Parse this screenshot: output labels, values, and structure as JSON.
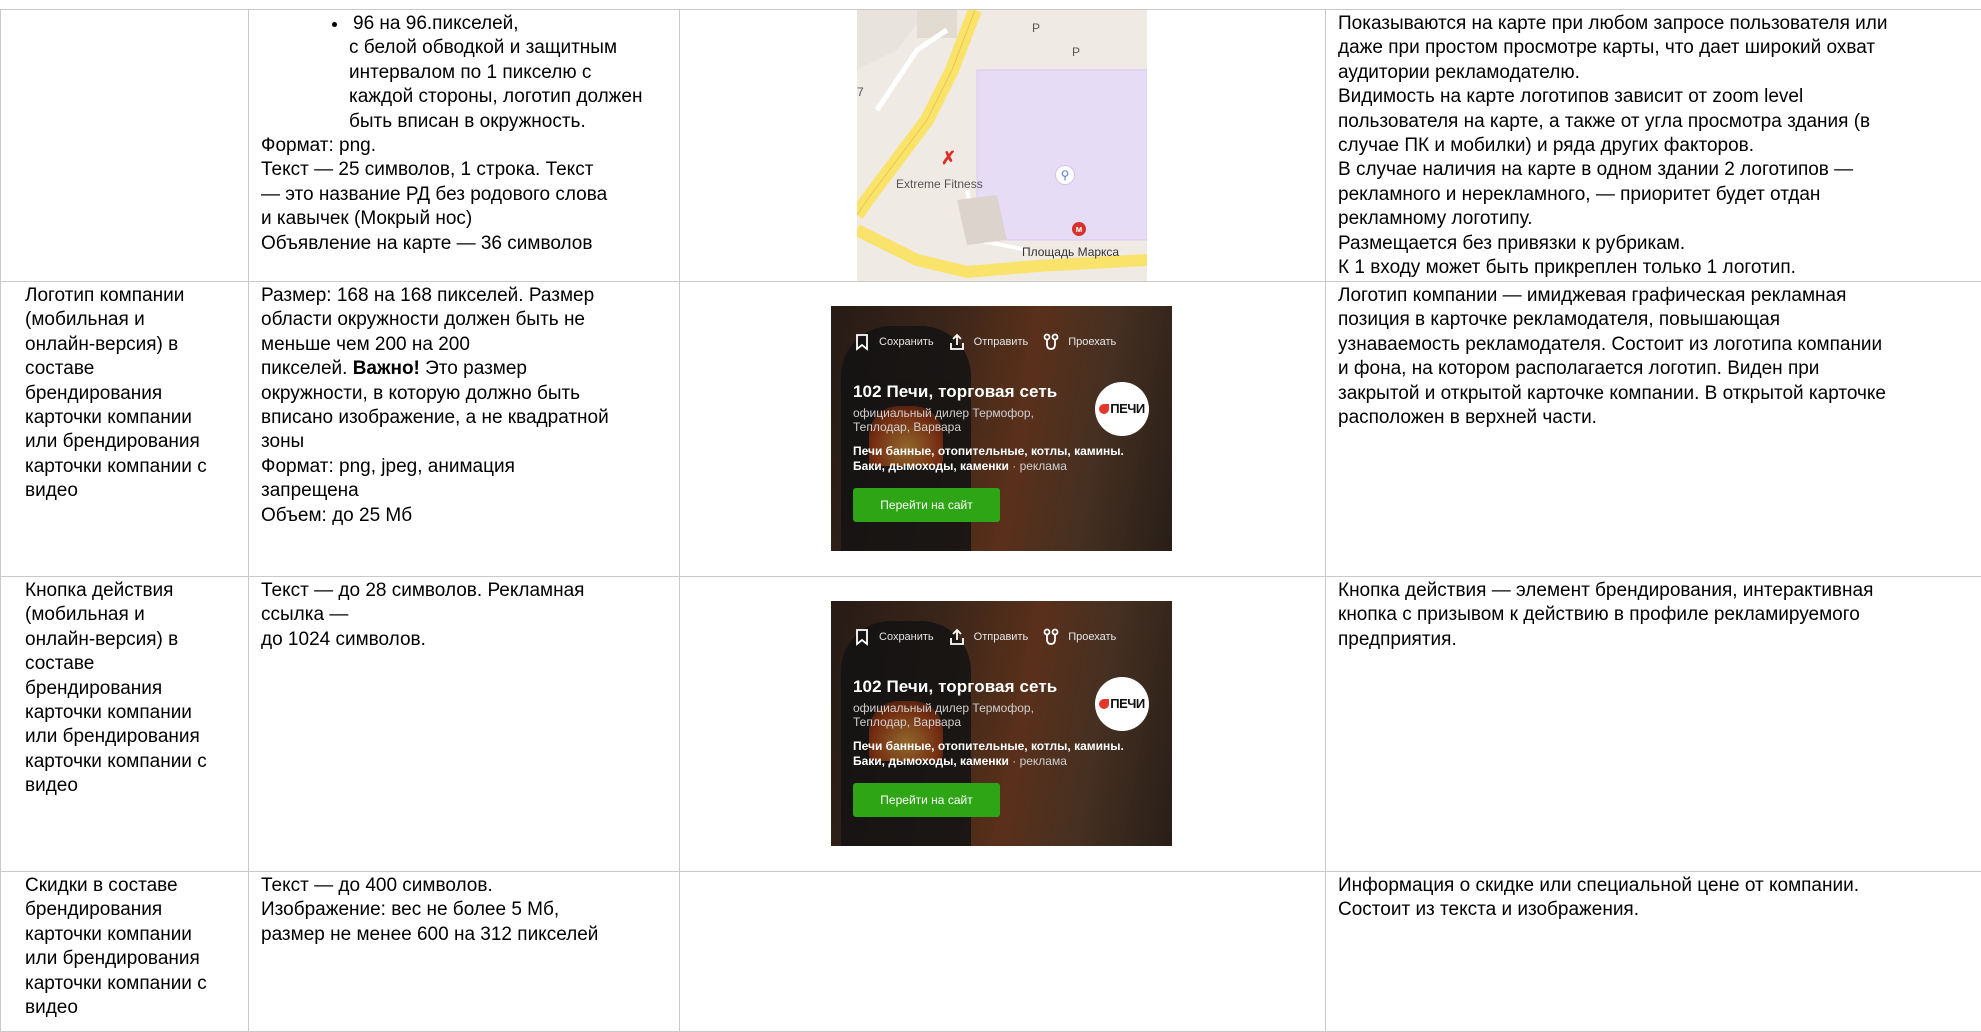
{
  "rows": [
    {
      "name": "",
      "requirements": {
        "bullet": "96 на 96.пикселей,",
        "indented": [
          "с белой обводкой и защитным",
          "интервалом по 1 пикселю с",
          "каждой стороны, логотип должен",
          "быть вписан в окружность."
        ],
        "lines": [
          "Формат: png.",
          "Текст — 25 символов, 1 строка. Текст",
          "— это название РД без родового слова",
          "и кавычек (Мокрый нос)",
          "Объявление на карте — 36 символов"
        ]
      },
      "description": [
        "Показываются на карте при любом запросе пользователя или",
        "даже при простом просмотре карты, что дает широкий охват",
        "аудитории рекламодателю.",
        "Видимость на карте логотипов зависит от zoom level",
        "пользователя на карте, а также от угла просмотра здания (в",
        "случае ПК и мобилки) и ряда других факторов.",
        "В случае наличия на карте в одном здании 2 логотипов —",
        "рекламного и нерекламного, — приоритет будет отдан",
        "рекламному логотипу.",
        "Размещается без привязки к рубрикам.",
        "К 1 входу может быть прикреплен только 1 логотип."
      ]
    },
    {
      "name": [
        "Логотип компании",
        "(мобильная и",
        "онлайн-версия) в",
        "составе",
        "брендирования",
        "карточки компании",
        "или брендирования",
        "карточки компании с",
        "видео"
      ],
      "requirements": {
        "line1": "Размер: 168 на 168 пикселей. Размер",
        "line2": "области окружности должен быть не",
        "line3": "меньше чем 200 на 200",
        "line4_pre": "пикселей. ",
        "line4_bold": "Важно!",
        "line4_post": " Это размер",
        "rest": [
          "окружности, в которую должно быть",
          "вписано изображение, а не квадратной",
          "зоны",
          "Формат: png, jpeg, анимация",
          "запрещена",
          "Объем: до 25 Мб"
        ]
      },
      "description": [
        "Логотип компании — имиджевая графическая рекламная",
        "позиция в карточке рекламодателя, повышающая",
        "узнаваемость рекламодателя. Состоит из логотипа компании",
        "и фона, на котором располагается логотип. Виден при",
        "закрытой и открытой карточке компании. В открытой карточке",
        "расположен в верхней части."
      ]
    },
    {
      "name": [
        "Кнопка действия",
        "(мобильная и",
        "онлайн-версия) в",
        "составе",
        "брендирования",
        "карточки компании",
        "или брендирования",
        "карточки компании с",
        "видео"
      ],
      "requirements": [
        "Текст — до 28 символов. Рекламная",
        "ссылка —",
        "до 1024 символов."
      ],
      "description": [
        "Кнопка действия — элемент брендирования, интерактивная",
        "кнопка с призывом к действию в профиле рекламируемого",
        "предприятия."
      ]
    },
    {
      "name": [
        "Скидки в составе",
        "брендирования",
        "карточки компании",
        "или брендирования",
        "карточки компании с",
        "видео"
      ],
      "requirements": [
        "Текст — до 400 символов.",
        "Изображение: вес не более 5 Мб,",
        "размер не менее 600 на 312 пикселей"
      ],
      "description": [
        "Информация о скидке или специальной цене от компании.",
        "Состоит из текста и изображения."
      ]
    }
  ],
  "map": {
    "place_label": "Extreme Fitness",
    "metro_label": "Площадь Маркса",
    "metro_letter": "м",
    "p1": "P",
    "p2": "P",
    "num": "7"
  },
  "card": {
    "save": "Сохранить",
    "send": "Отправить",
    "route": "Проехать",
    "title": "102 Печи, торговая сеть",
    "sub": "официальный дилер Термофор, Теплодар, Варвара",
    "desc": "Печи банные, отопительные, котлы, камины. Баки, дымоходы, каменки",
    "ad": " · реклама",
    "logo": "ПЕЧИ",
    "button": "Перейти на сайт"
  },
  "colors": {
    "border": "#c9c9c9",
    "button": "#2ea515",
    "map_zone": "#e6dcf5",
    "road": "#f9e36b"
  }
}
